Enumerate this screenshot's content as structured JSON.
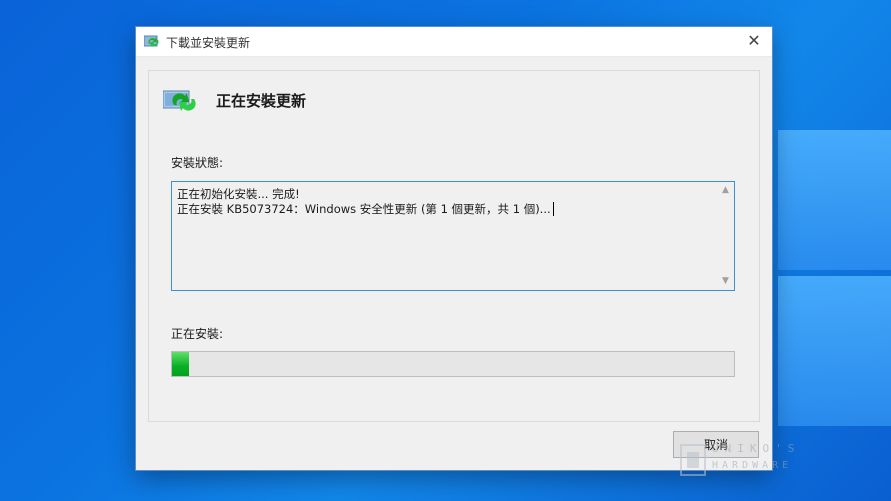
{
  "window": {
    "title": "下載並安裝更新",
    "close_glyph": "✕",
    "icon": "windows-update-icon"
  },
  "header": {
    "title": "正在安裝更新",
    "icon": "windows-update-icon"
  },
  "status": {
    "label": "安裝狀態:",
    "log_lines": [
      "正在初始化安裝... 完成!",
      "正在安裝 KB5073724：Windows 安全性更新 (第 1 個更新，共 1 個)..."
    ]
  },
  "progress": {
    "label": "正在安裝:",
    "value_percent": 3
  },
  "buttons": {
    "cancel_label": "取消"
  },
  "watermark": {
    "line1": "UNIKO'S",
    "line2": "HARDWARE"
  },
  "colors": {
    "accent": "#06b025",
    "textbox_border": "#3c8fd0",
    "desktop": "#0b74e0"
  }
}
